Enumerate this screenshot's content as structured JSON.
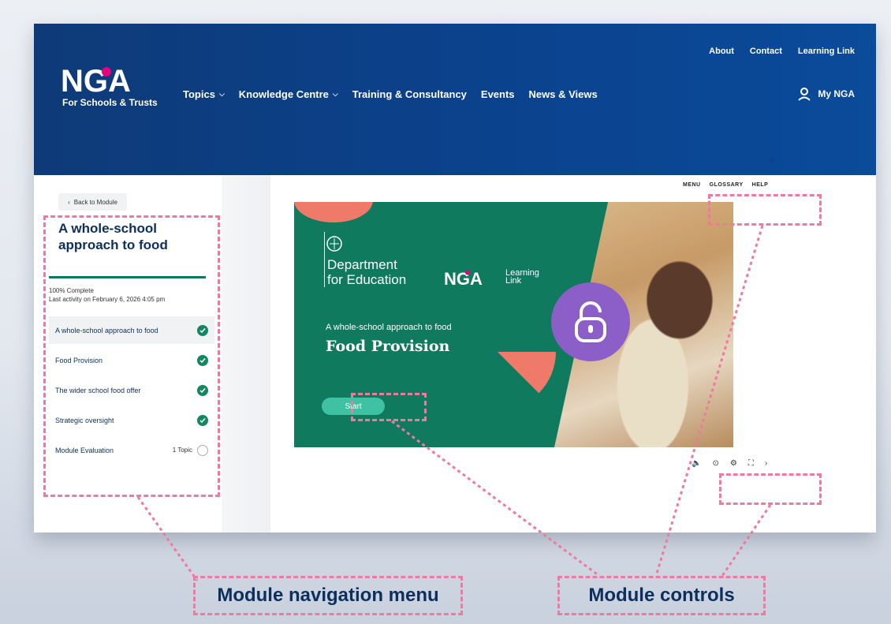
{
  "header": {
    "logo_text": "NGA",
    "tagline": "For Schools & Trusts",
    "nav": [
      "Topics",
      "Knowledge Centre",
      "Training & Consultancy",
      "Events",
      "News & Views"
    ],
    "utility": [
      "About",
      "Contact",
      "Learning Link"
    ],
    "account": "My NGA"
  },
  "sidebar": {
    "back": "Back to Module",
    "title": "A whole-school approach to food",
    "progress": "100% Complete",
    "last_activity": "Last activity on February 6, 2026 4:05 pm",
    "lessons": [
      {
        "label": "A whole-school approach to food",
        "done": true
      },
      {
        "label": "Food Provision",
        "done": true
      },
      {
        "label": "The wider school food offer",
        "done": true
      },
      {
        "label": "Strategic oversight",
        "done": true
      },
      {
        "label": "Module Evaluation",
        "done": false,
        "meta": "1 Topic"
      }
    ]
  },
  "controls": {
    "menu": "MENU",
    "glossary": "GLOSSARY",
    "help": "HELP"
  },
  "slide": {
    "dept_line1": "Department",
    "dept_line2": "for Education",
    "ll_line1": "Learning",
    "ll_line2": "Link",
    "subtitle": "A whole-school approach to food",
    "title": "Food Provision",
    "start": "Start"
  },
  "annotations": {
    "nav_menu": "Module navigation menu",
    "controls": "Module controls"
  },
  "colors": {
    "header": "#0b438f",
    "accent": "#ef7aa0",
    "slide": "#0f7a5e",
    "check": "#13875f"
  }
}
